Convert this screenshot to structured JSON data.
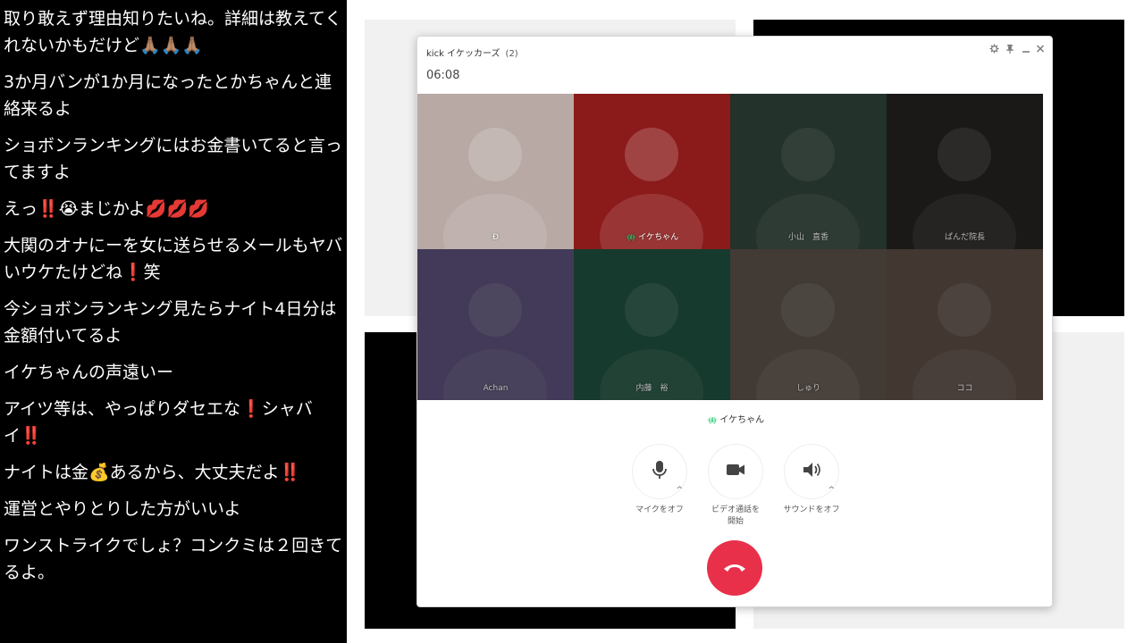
{
  "chat": {
    "messages": [
      "取り敢えず理由知りたいね。詳細は教えてくれないかもだけど🙏🏽🙏🏽🙏🏽",
      "3か月バンが1か月になったとかちゃんと連絡来るよ",
      "ショボンランキングにはお金書いてると言ってますよ",
      "えっ‼️😭まじかよ💋💋💋",
      "大関のオナにーを女に送らせるメールもヤバいウケたけどね❗️笑",
      "今ショボンランキング見たらナイト4日分は金額付いてるよ",
      "イケちゃんの声遠いー",
      "アイツ等は、やっぱりダセエな❗️シャバイ‼️",
      "ナイトは金💰あるから、大丈夫だよ‼️",
      "運営とやりとりした方がいいよ",
      "ワンストライクでしょ？コンクミは２回きてるよ。"
    ]
  },
  "call": {
    "title": "kick イケッカーズ",
    "count": "(2)",
    "timer": "06:08",
    "window_controls": {
      "settings_icon": "⚙",
      "pin_icon": "📌",
      "minimize": "_",
      "close": "×"
    },
    "participants": [
      {
        "name": "Đ",
        "speaking": false,
        "dim": false,
        "icon": "person-silhouette",
        "bg": "#b8a9a4"
      },
      {
        "name": "イケちゃん",
        "speaking": true,
        "dim": false,
        "icon": "person-portrait",
        "bg": "#8b1a1a"
      },
      {
        "name": "小山　直香",
        "speaking": false,
        "dim": true,
        "icon": "person-outdoor",
        "bg": "#4a6a5a"
      },
      {
        "name": "ぱんだ院長",
        "speaking": false,
        "dim": true,
        "icon": "person-suit",
        "bg": "#3a3530"
      },
      {
        "name": "Achan",
        "speaking": false,
        "dim": true,
        "icon": "cartoon-bear",
        "bg": "#8a7ab8"
      },
      {
        "name": "内藤　裕",
        "speaking": false,
        "dim": true,
        "icon": "person-placeholder",
        "bg": "#2e7a5e"
      },
      {
        "name": "しゅり",
        "speaking": false,
        "dim": true,
        "icon": "person-female",
        "bg": "#8a7a70"
      },
      {
        "name": "ココ",
        "speaking": false,
        "dim": true,
        "icon": "person-female",
        "bg": "#8a7468"
      }
    ],
    "active_speaker": "イケちゃん",
    "controls": {
      "mic_label": "マイクをオフ",
      "video_label_line1": "ビデオ通話を",
      "video_label_line2": "開始",
      "sound_label": "サウンドをオフ"
    },
    "colors": {
      "end_call": "#e8304a",
      "audio_wave": "#1ecb6b"
    }
  }
}
